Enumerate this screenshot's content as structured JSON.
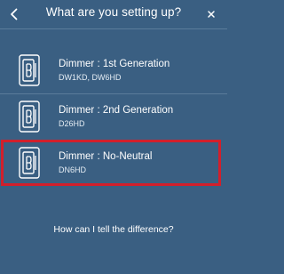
{
  "header": {
    "title": "What are you setting up?",
    "back_icon": "chevron-left-icon",
    "close_icon": "close-icon"
  },
  "options": [
    {
      "label": "Dimmer : 1st Generation",
      "model": "DW1KD, DW6HD",
      "icon": "dimmer-switch-icon"
    },
    {
      "label": "Dimmer : 2nd Generation",
      "model": "D26HD",
      "icon": "dimmer-switch-icon"
    },
    {
      "label": "Dimmer : No-Neutral",
      "model": "DN6HD",
      "icon": "dimmer-switch-icon",
      "selected": true
    }
  ],
  "help_link": "How can I tell the difference?",
  "colors": {
    "background": "#3a5f82",
    "divider": "#5b7c9b",
    "highlight": "#d21f2b",
    "text": "#ffffff"
  }
}
